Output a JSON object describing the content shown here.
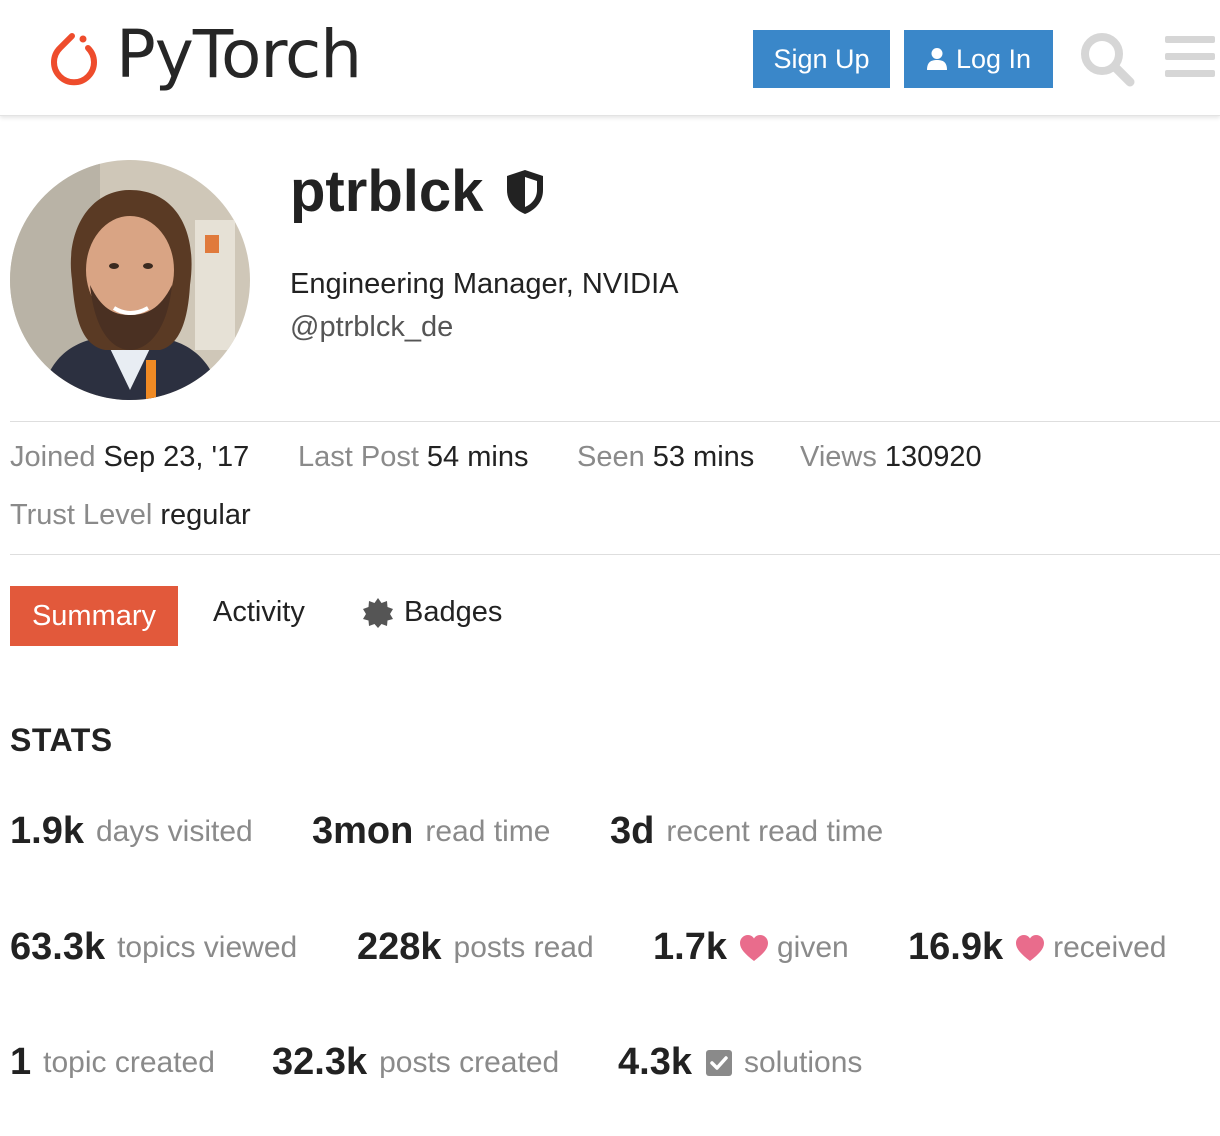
{
  "header": {
    "logo_text": "PyTorch",
    "signup_label": "Sign Up",
    "login_label": "Log In",
    "brand_color": "#ee4c2c",
    "button_color": "#3a87c9",
    "icons": [
      "pytorch-logo-icon",
      "user-icon",
      "search-icon",
      "hamburger-menu-icon"
    ]
  },
  "profile": {
    "username": "ptrblck",
    "title": "Engineering Manager, NVIDIA",
    "handle": "@ptrblck_de",
    "icons": [
      "moderator-shield-icon"
    ]
  },
  "meta": {
    "joined_label": "Joined",
    "joined_value": "Sep 23, '17",
    "last_post_label": "Last Post",
    "last_post_value": "54 mins",
    "seen_label": "Seen",
    "seen_value": "53 mins",
    "views_label": "Views",
    "views_value": "130920",
    "trust_label": "Trust Level",
    "trust_value": "regular"
  },
  "nav": {
    "summary": "Summary",
    "activity": "Activity",
    "badges": "Badges",
    "active_color": "#e2593b"
  },
  "stats": {
    "heading": "STATS",
    "days_visited": {
      "value": "1.9k",
      "label": "days visited"
    },
    "read_time": {
      "value": "3mon",
      "label": "read time"
    },
    "recent_read_time": {
      "value": "3d",
      "label": "recent read time"
    },
    "topics_viewed": {
      "value": "63.3k",
      "label": "topics viewed"
    },
    "posts_read": {
      "value": "228k",
      "label": "posts read"
    },
    "likes_given": {
      "value": "1.7k",
      "label": "given"
    },
    "likes_received": {
      "value": "16.9k",
      "label": "received"
    },
    "topic_created": {
      "value": "1",
      "label": "topic created"
    },
    "posts_created": {
      "value": "32.3k",
      "label": "posts created"
    },
    "solutions": {
      "value": "4.3k",
      "label": "solutions"
    },
    "heart_color": "#e96c8c"
  }
}
